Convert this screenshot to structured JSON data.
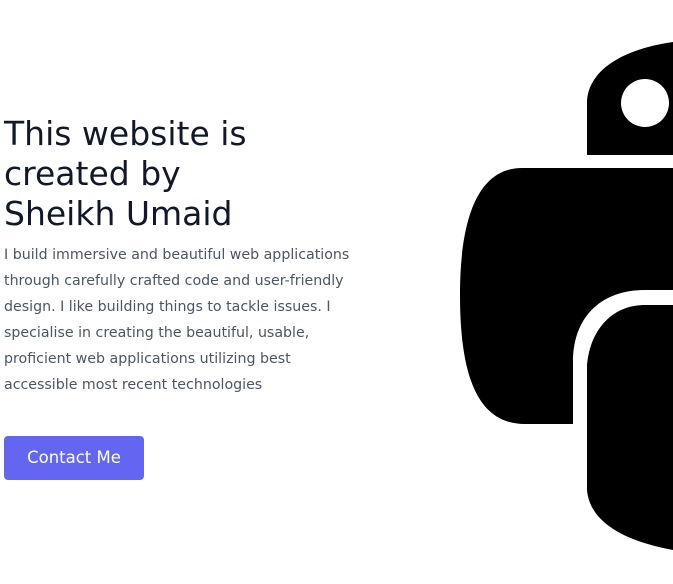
{
  "hero": {
    "title_lines": [
      "This website is",
      "created by",
      "Sheikh Umaid"
    ],
    "description_lines": [
      "I build immersive and beautiful web applications",
      "through carefully crafted code and user-friendly",
      "design. I like building things to tackle issues. I",
      "specialise in creating the beautiful, usable,",
      "proficient web applications utilizing best",
      "accessible most recent technologies"
    ],
    "contact_button_label": "Contact Me"
  },
  "illustration": {
    "icon": "python-logo-icon",
    "color": "#000000"
  },
  "colors": {
    "accent": "#6366f1",
    "title": "#111827",
    "body_text": "#4b5563",
    "background": "#ffffff"
  }
}
